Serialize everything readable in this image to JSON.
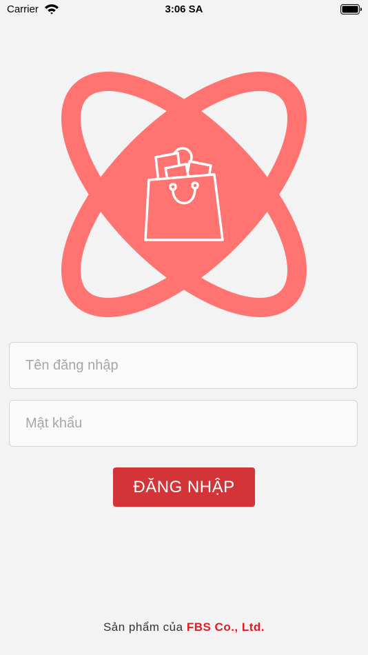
{
  "status_bar": {
    "carrier": "Carrier",
    "time": "3:06 SA",
    "wifi_icon": "wifi-icon",
    "battery_icon": "battery-icon"
  },
  "logo": {
    "icon": "shopping-bag-icon",
    "color": "#ff7371"
  },
  "login_form": {
    "username_placeholder": "Tên đăng nhập",
    "password_placeholder": "Mật khẩu",
    "login_button_label": "ĐĂNG NHẬP",
    "button_color": "#d33438"
  },
  "footer": {
    "prefix": "Sản phẩm của ",
    "company": "FBS Co., Ltd.",
    "company_color": "#e5191f"
  }
}
